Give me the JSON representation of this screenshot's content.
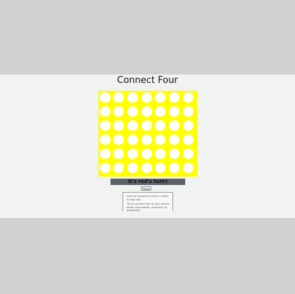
{
  "game": {
    "title": "Connect Four",
    "status": "It's red's turn!",
    "reset_label": "Reset",
    "instructions": [
      "Click on squares to place a piece in that slot.",
      "Try to connect four of your pieces either horizontally, vertically, or diagonally."
    ],
    "board": {
      "rows": 6,
      "columns": 7,
      "cells": [
        [
          "empty",
          "empty",
          "empty",
          "empty",
          "empty",
          "empty",
          "empty"
        ],
        [
          "empty",
          "empty",
          "empty",
          "empty",
          "empty",
          "empty",
          "empty"
        ],
        [
          "empty",
          "empty",
          "empty",
          "empty",
          "empty",
          "empty",
          "empty"
        ],
        [
          "empty",
          "empty",
          "empty",
          "empty",
          "empty",
          "empty",
          "empty"
        ],
        [
          "empty",
          "empty",
          "empty",
          "empty",
          "empty",
          "empty",
          "empty"
        ],
        [
          "empty",
          "empty",
          "empty",
          "empty",
          "empty",
          "empty",
          "empty"
        ]
      ]
    }
  },
  "colors": {
    "page_background": "#cfd0d1",
    "panel_background": "#f1f2f2",
    "board": "#ffff00",
    "empty_cell": "#ffffff",
    "red_piece": "#e53935",
    "yellow_piece": "#fdd835",
    "status_bar": "#5c6368"
  }
}
